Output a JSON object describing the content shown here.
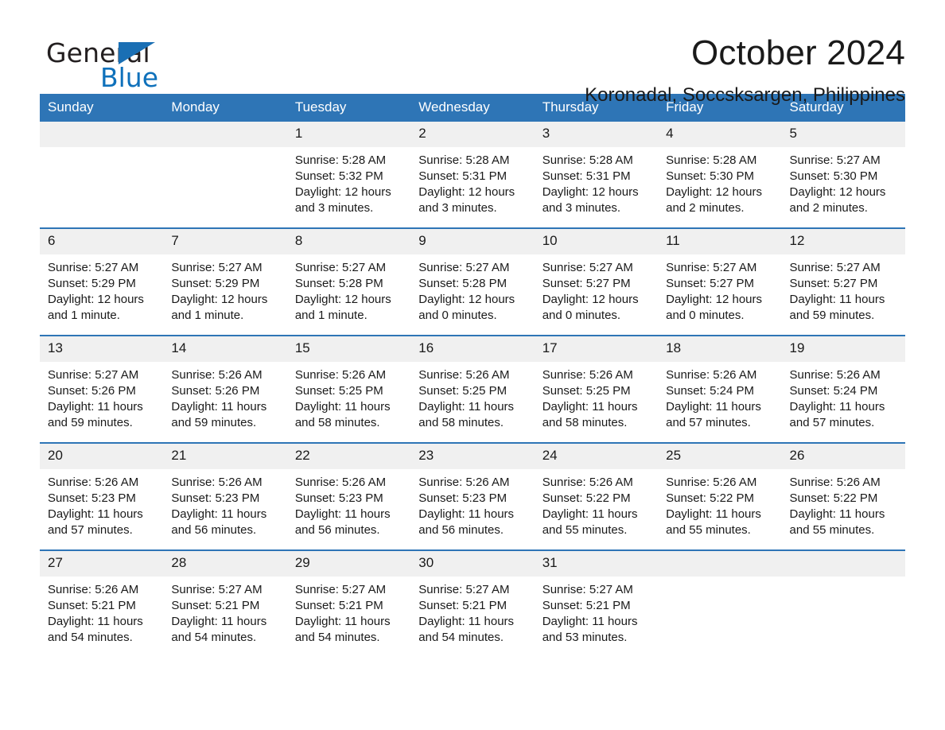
{
  "brand": {
    "name_part1": "General",
    "name_part2": "Blue",
    "triangle_color": "#1a6fb4",
    "blue": "#0f71bb"
  },
  "header": {
    "title": "October 2024",
    "location": "Koronadal, Soccsksargen, Philippines",
    "accent_color": "#2e75b6",
    "daynum_band_color": "#f0f0f0"
  },
  "weekdays": [
    "Sunday",
    "Monday",
    "Tuesday",
    "Wednesday",
    "Thursday",
    "Friday",
    "Saturday"
  ],
  "weeks": [
    [
      {
        "day": "",
        "sunrise": "",
        "sunset": "",
        "daylight_l1": "",
        "daylight_l2": "",
        "blank": true
      },
      {
        "day": "",
        "sunrise": "",
        "sunset": "",
        "daylight_l1": "",
        "daylight_l2": "",
        "blank": true
      },
      {
        "day": "1",
        "sunrise": "Sunrise: 5:28 AM",
        "sunset": "Sunset: 5:32 PM",
        "daylight_l1": "Daylight: 12 hours",
        "daylight_l2": "and 3 minutes."
      },
      {
        "day": "2",
        "sunrise": "Sunrise: 5:28 AM",
        "sunset": "Sunset: 5:31 PM",
        "daylight_l1": "Daylight: 12 hours",
        "daylight_l2": "and 3 minutes."
      },
      {
        "day": "3",
        "sunrise": "Sunrise: 5:28 AM",
        "sunset": "Sunset: 5:31 PM",
        "daylight_l1": "Daylight: 12 hours",
        "daylight_l2": "and 3 minutes."
      },
      {
        "day": "4",
        "sunrise": "Sunrise: 5:28 AM",
        "sunset": "Sunset: 5:30 PM",
        "daylight_l1": "Daylight: 12 hours",
        "daylight_l2": "and 2 minutes."
      },
      {
        "day": "5",
        "sunrise": "Sunrise: 5:27 AM",
        "sunset": "Sunset: 5:30 PM",
        "daylight_l1": "Daylight: 12 hours",
        "daylight_l2": "and 2 minutes."
      }
    ],
    [
      {
        "day": "6",
        "sunrise": "Sunrise: 5:27 AM",
        "sunset": "Sunset: 5:29 PM",
        "daylight_l1": "Daylight: 12 hours",
        "daylight_l2": "and 1 minute."
      },
      {
        "day": "7",
        "sunrise": "Sunrise: 5:27 AM",
        "sunset": "Sunset: 5:29 PM",
        "daylight_l1": "Daylight: 12 hours",
        "daylight_l2": "and 1 minute."
      },
      {
        "day": "8",
        "sunrise": "Sunrise: 5:27 AM",
        "sunset": "Sunset: 5:28 PM",
        "daylight_l1": "Daylight: 12 hours",
        "daylight_l2": "and 1 minute."
      },
      {
        "day": "9",
        "sunrise": "Sunrise: 5:27 AM",
        "sunset": "Sunset: 5:28 PM",
        "daylight_l1": "Daylight: 12 hours",
        "daylight_l2": "and 0 minutes."
      },
      {
        "day": "10",
        "sunrise": "Sunrise: 5:27 AM",
        "sunset": "Sunset: 5:27 PM",
        "daylight_l1": "Daylight: 12 hours",
        "daylight_l2": "and 0 minutes."
      },
      {
        "day": "11",
        "sunrise": "Sunrise: 5:27 AM",
        "sunset": "Sunset: 5:27 PM",
        "daylight_l1": "Daylight: 12 hours",
        "daylight_l2": "and 0 minutes."
      },
      {
        "day": "12",
        "sunrise": "Sunrise: 5:27 AM",
        "sunset": "Sunset: 5:27 PM",
        "daylight_l1": "Daylight: 11 hours",
        "daylight_l2": "and 59 minutes."
      }
    ],
    [
      {
        "day": "13",
        "sunrise": "Sunrise: 5:27 AM",
        "sunset": "Sunset: 5:26 PM",
        "daylight_l1": "Daylight: 11 hours",
        "daylight_l2": "and 59 minutes."
      },
      {
        "day": "14",
        "sunrise": "Sunrise: 5:26 AM",
        "sunset": "Sunset: 5:26 PM",
        "daylight_l1": "Daylight: 11 hours",
        "daylight_l2": "and 59 minutes."
      },
      {
        "day": "15",
        "sunrise": "Sunrise: 5:26 AM",
        "sunset": "Sunset: 5:25 PM",
        "daylight_l1": "Daylight: 11 hours",
        "daylight_l2": "and 58 minutes."
      },
      {
        "day": "16",
        "sunrise": "Sunrise: 5:26 AM",
        "sunset": "Sunset: 5:25 PM",
        "daylight_l1": "Daylight: 11 hours",
        "daylight_l2": "and 58 minutes."
      },
      {
        "day": "17",
        "sunrise": "Sunrise: 5:26 AM",
        "sunset": "Sunset: 5:25 PM",
        "daylight_l1": "Daylight: 11 hours",
        "daylight_l2": "and 58 minutes."
      },
      {
        "day": "18",
        "sunrise": "Sunrise: 5:26 AM",
        "sunset": "Sunset: 5:24 PM",
        "daylight_l1": "Daylight: 11 hours",
        "daylight_l2": "and 57 minutes."
      },
      {
        "day": "19",
        "sunrise": "Sunrise: 5:26 AM",
        "sunset": "Sunset: 5:24 PM",
        "daylight_l1": "Daylight: 11 hours",
        "daylight_l2": "and 57 minutes."
      }
    ],
    [
      {
        "day": "20",
        "sunrise": "Sunrise: 5:26 AM",
        "sunset": "Sunset: 5:23 PM",
        "daylight_l1": "Daylight: 11 hours",
        "daylight_l2": "and 57 minutes."
      },
      {
        "day": "21",
        "sunrise": "Sunrise: 5:26 AM",
        "sunset": "Sunset: 5:23 PM",
        "daylight_l1": "Daylight: 11 hours",
        "daylight_l2": "and 56 minutes."
      },
      {
        "day": "22",
        "sunrise": "Sunrise: 5:26 AM",
        "sunset": "Sunset: 5:23 PM",
        "daylight_l1": "Daylight: 11 hours",
        "daylight_l2": "and 56 minutes."
      },
      {
        "day": "23",
        "sunrise": "Sunrise: 5:26 AM",
        "sunset": "Sunset: 5:23 PM",
        "daylight_l1": "Daylight: 11 hours",
        "daylight_l2": "and 56 minutes."
      },
      {
        "day": "24",
        "sunrise": "Sunrise: 5:26 AM",
        "sunset": "Sunset: 5:22 PM",
        "daylight_l1": "Daylight: 11 hours",
        "daylight_l2": "and 55 minutes."
      },
      {
        "day": "25",
        "sunrise": "Sunrise: 5:26 AM",
        "sunset": "Sunset: 5:22 PM",
        "daylight_l1": "Daylight: 11 hours",
        "daylight_l2": "and 55 minutes."
      },
      {
        "day": "26",
        "sunrise": "Sunrise: 5:26 AM",
        "sunset": "Sunset: 5:22 PM",
        "daylight_l1": "Daylight: 11 hours",
        "daylight_l2": "and 55 minutes."
      }
    ],
    [
      {
        "day": "27",
        "sunrise": "Sunrise: 5:26 AM",
        "sunset": "Sunset: 5:21 PM",
        "daylight_l1": "Daylight: 11 hours",
        "daylight_l2": "and 54 minutes."
      },
      {
        "day": "28",
        "sunrise": "Sunrise: 5:27 AM",
        "sunset": "Sunset: 5:21 PM",
        "daylight_l1": "Daylight: 11 hours",
        "daylight_l2": "and 54 minutes."
      },
      {
        "day": "29",
        "sunrise": "Sunrise: 5:27 AM",
        "sunset": "Sunset: 5:21 PM",
        "daylight_l1": "Daylight: 11 hours",
        "daylight_l2": "and 54 minutes."
      },
      {
        "day": "30",
        "sunrise": "Sunrise: 5:27 AM",
        "sunset": "Sunset: 5:21 PM",
        "daylight_l1": "Daylight: 11 hours",
        "daylight_l2": "and 54 minutes."
      },
      {
        "day": "31",
        "sunrise": "Sunrise: 5:27 AM",
        "sunset": "Sunset: 5:21 PM",
        "daylight_l1": "Daylight: 11 hours",
        "daylight_l2": "and 53 minutes."
      },
      {
        "day": "",
        "sunrise": "",
        "sunset": "",
        "daylight_l1": "",
        "daylight_l2": "",
        "blank": true
      },
      {
        "day": "",
        "sunrise": "",
        "sunset": "",
        "daylight_l1": "",
        "daylight_l2": "",
        "blank": true
      }
    ]
  ]
}
